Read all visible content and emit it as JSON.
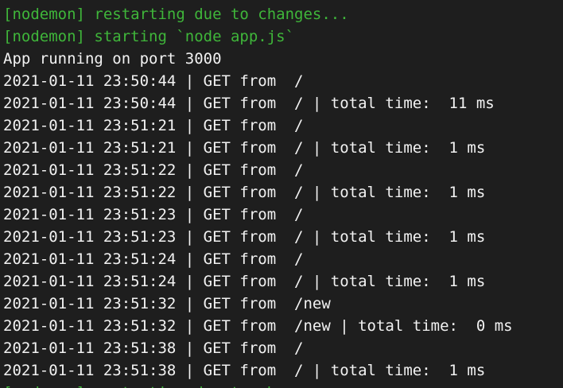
{
  "colors": {
    "background": "#1e1e1e",
    "text": "#f2f2f2",
    "nodemon_green": "#3fb63a"
  },
  "terminal": {
    "lines": [
      {
        "text": "[nodemon] restarting due to changes...",
        "style": "green"
      },
      {
        "text": "[nodemon] starting `node app.js`",
        "style": "green"
      },
      {
        "text": "App running on port 3000",
        "style": "normal"
      },
      {
        "text": "2021-01-11 23:50:44 | GET from  /",
        "style": "normal"
      },
      {
        "text": "2021-01-11 23:50:44 | GET from  / | total time:  11 ms",
        "style": "normal"
      },
      {
        "text": "2021-01-11 23:51:21 | GET from  /",
        "style": "normal"
      },
      {
        "text": "2021-01-11 23:51:21 | GET from  / | total time:  1 ms",
        "style": "normal"
      },
      {
        "text": "2021-01-11 23:51:22 | GET from  /",
        "style": "normal"
      },
      {
        "text": "2021-01-11 23:51:22 | GET from  / | total time:  1 ms",
        "style": "normal"
      },
      {
        "text": "2021-01-11 23:51:23 | GET from  /",
        "style": "normal"
      },
      {
        "text": "2021-01-11 23:51:23 | GET from  / | total time:  1 ms",
        "style": "normal"
      },
      {
        "text": "2021-01-11 23:51:24 | GET from  /",
        "style": "normal"
      },
      {
        "text": "2021-01-11 23:51:24 | GET from  / | total time:  1 ms",
        "style": "normal"
      },
      {
        "text": "2021-01-11 23:51:32 | GET from  /new",
        "style": "normal"
      },
      {
        "text": "2021-01-11 23:51:32 | GET from  /new | total time:  0 ms",
        "style": "normal"
      },
      {
        "text": "2021-01-11 23:51:38 | GET from  /",
        "style": "normal"
      },
      {
        "text": "2021-01-11 23:51:38 | GET from  / | total time:  1 ms",
        "style": "normal"
      },
      {
        "text": "[nodemon] restarting due to changes...",
        "style": "green"
      }
    ]
  }
}
